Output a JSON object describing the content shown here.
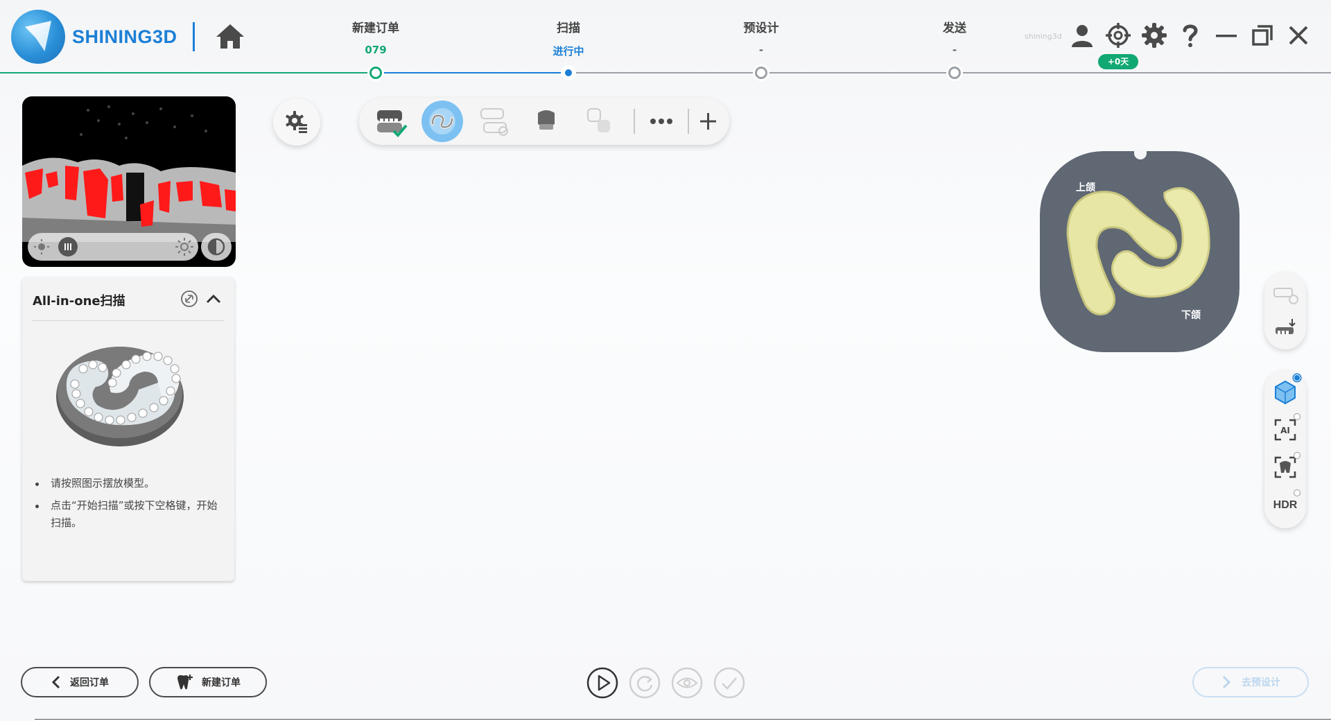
{
  "app": {
    "brand": "SHINING3D",
    "user_name": "shining3d",
    "days_badge": "+0天",
    "colors": {
      "accent": "#1b7fd6",
      "complete": "#12a873",
      "badge": "#12a873",
      "inactive": "#9aa0a6"
    }
  },
  "steps": [
    {
      "title": "新建订单",
      "sub": "079",
      "state": "done"
    },
    {
      "title": "扫描",
      "sub": "进行中",
      "state": "active"
    },
    {
      "title": "预设计",
      "sub": "-",
      "state": "pending"
    },
    {
      "title": "发送",
      "sub": "-",
      "state": "pending"
    }
  ],
  "header_icons": [
    "home-icon",
    "user-icon",
    "crosshair-icon",
    "gear-icon",
    "help-icon",
    "minimize-icon",
    "restore-icon",
    "close-icon"
  ],
  "info_card": {
    "title": "All-in-one扫描",
    "instructions": [
      "请按照图示摆放模型。",
      "点击“开始扫描”或按下空格键，开始扫描。"
    ]
  },
  "preview": {
    "upper_label": "上颌",
    "lower_label": "下颌"
  },
  "side_tools": {
    "hdr_label": "HDR"
  },
  "bottom": {
    "back_label": "返回订单",
    "new_order_label": "新建订单",
    "next_label": "去预设计"
  }
}
